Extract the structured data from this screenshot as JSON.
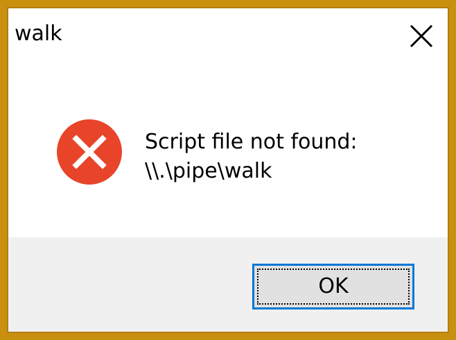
{
  "dialog": {
    "title": "walk",
    "message_line1": "Script file not found:",
    "message_line2": "\\\\.\\pipe\\walk",
    "icon": "error-icon",
    "close_icon": "close-icon",
    "ok_label": "OK"
  },
  "colors": {
    "outer_background": "#c9900f",
    "window_background": "#ffffff",
    "footer_background": "#f0f0f0",
    "error_red": "#e8442a",
    "button_focus_border": "#0078d7",
    "button_background": "#e1e1e1"
  }
}
